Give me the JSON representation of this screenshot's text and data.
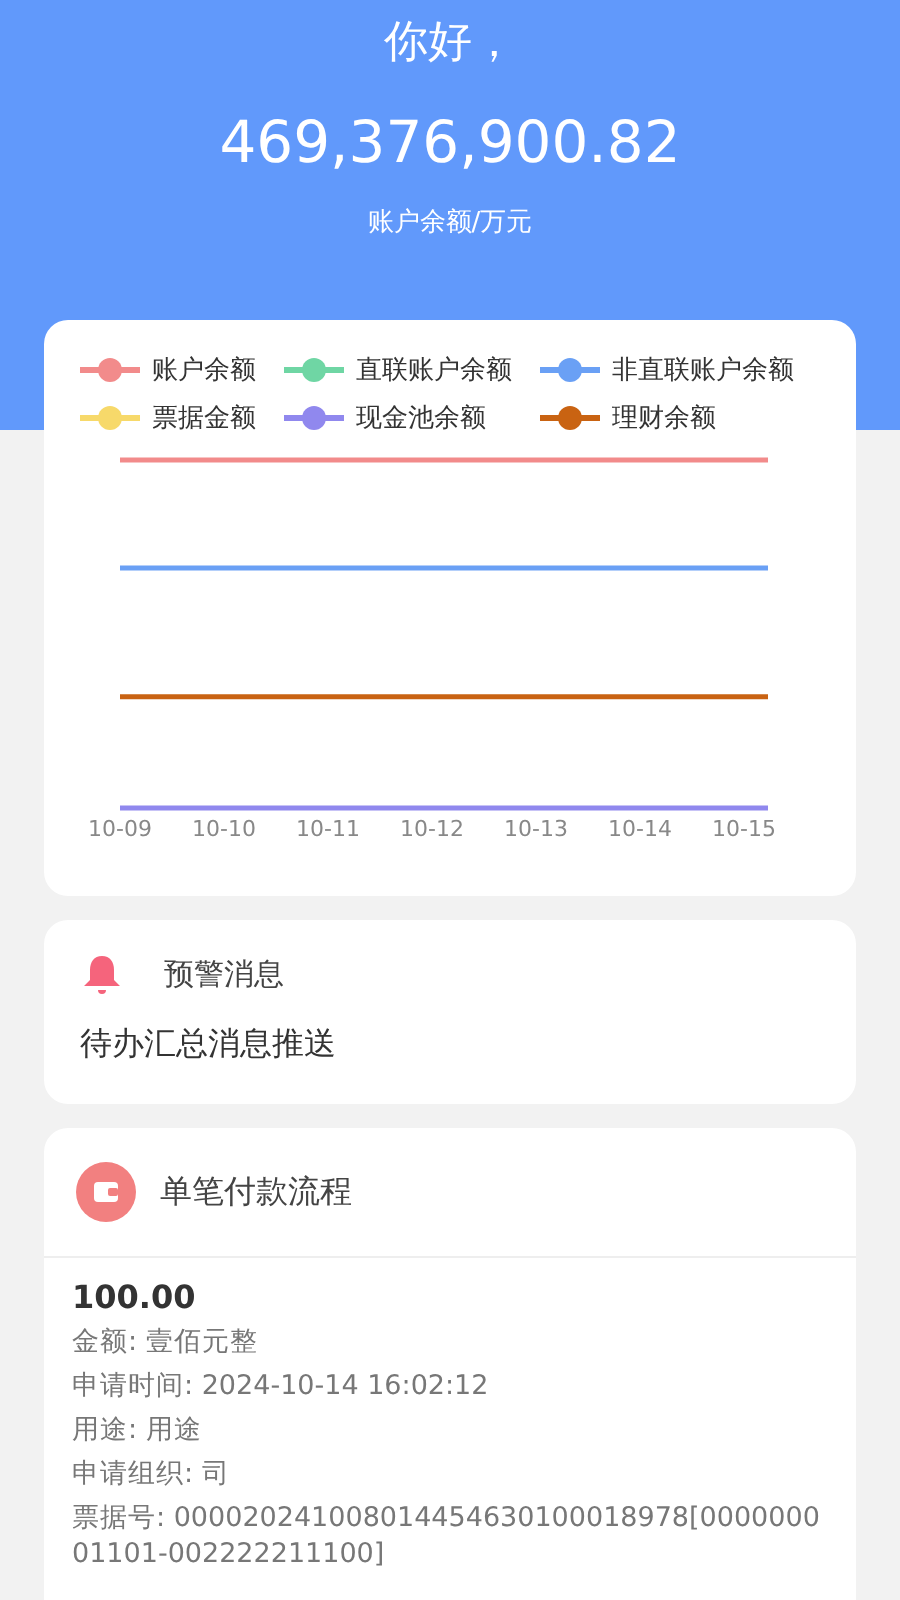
{
  "header": {
    "greeting": "你好，",
    "balance": "469,376,900.82",
    "balance_label": "账户余额/万元"
  },
  "chart": {
    "legend": [
      {
        "name": "账户余额",
        "color": "#f28b8b"
      },
      {
        "name": "直联账户余额",
        "color": "#6fd6a4"
      },
      {
        "name": "非直联账户余额",
        "color": "#6aa0f5"
      },
      {
        "name": "票据金额",
        "color": "#f7d96a"
      },
      {
        "name": "现金池余额",
        "color": "#9088ee"
      },
      {
        "name": "理财余额",
        "color": "#c96312"
      }
    ],
    "x_labels": [
      "10-09",
      "10-10",
      "10-11",
      "10-12",
      "10-13",
      "10-14",
      "10-15"
    ]
  },
  "alert": {
    "title": "预警消息",
    "message": "待办汇总消息推送"
  },
  "payment": {
    "title": "单笔付款流程",
    "amount": "100.00",
    "lines": [
      "金额: 壹佰元整",
      "申请时间: 2024-10-14 16:02:12",
      "用途: 用途",
      "申请组织: 司",
      "票据号: 0000202410080144546301000189​78[000000001101-002222211100]"
    ]
  }
}
